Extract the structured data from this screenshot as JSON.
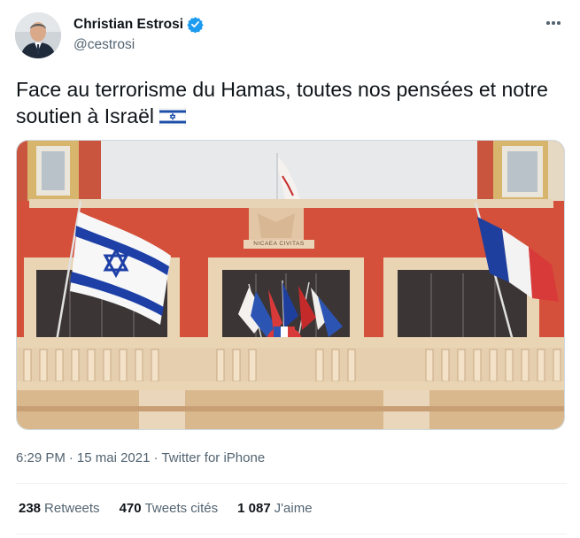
{
  "author": {
    "display_name": "Christian Estrosi",
    "handle": "@cestrosi",
    "verified": true
  },
  "tweet": {
    "text": "Face au terrorisme du Hamas, toutes nos pensées et notre soutien à Israël",
    "emoji": "flag-israel"
  },
  "meta": {
    "time": "6:29 PM",
    "separator": "·",
    "date": "15 mai 2021",
    "source": "Twitter for iPhone"
  },
  "stats": {
    "retweets_count": "238",
    "retweets_label": "Retweets",
    "quotes_count": "470",
    "quotes_label": "Tweets cités",
    "likes_count": "1 087",
    "likes_label": "J'aime"
  },
  "photo": {
    "building_inscription": "NICAEA CIVITAS"
  },
  "colors": {
    "verified_blue": "#1d9bf0",
    "text_primary": "#0f1419",
    "text_secondary": "#536471",
    "divider": "#eff3f4",
    "facade": "#d4503a"
  },
  "icons": {
    "more": "more-dots-icon",
    "verified": "verified-badge-icon"
  }
}
